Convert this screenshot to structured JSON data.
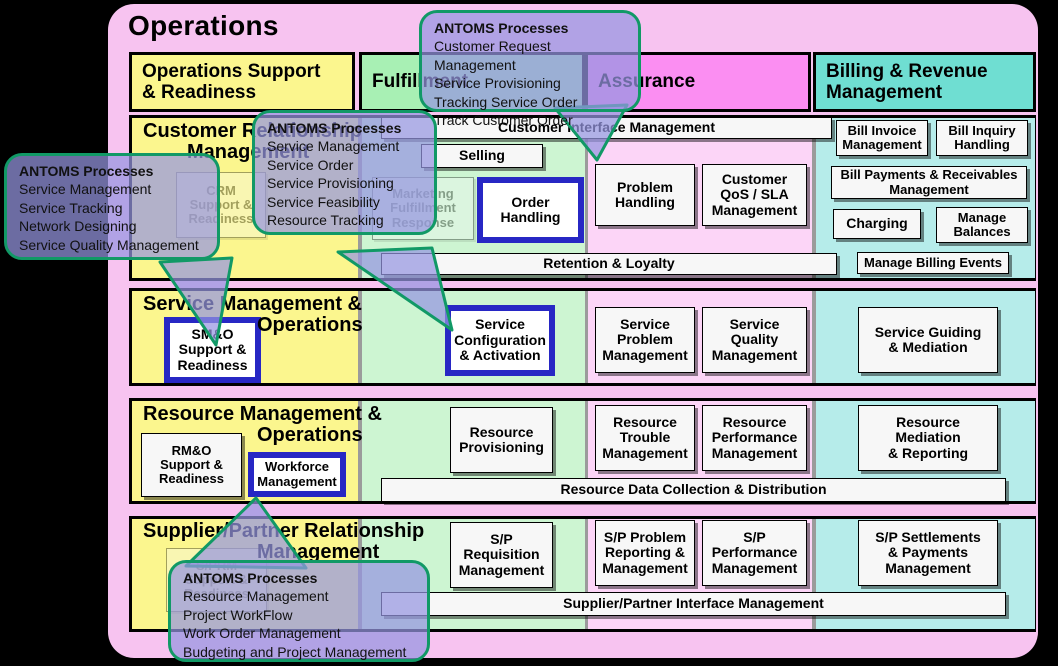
{
  "title": "Operations",
  "columns": [
    {
      "id": "osr",
      "label": "Operations Support\n& Readiness",
      "color": "#fbf68e"
    },
    {
      "id": "fulfillment",
      "label": "Fulfillment",
      "color": "#a8f0b4"
    },
    {
      "id": "assurance",
      "label": "Assurance",
      "color": "#fb8ef2"
    },
    {
      "id": "billing",
      "label": "Billing & Revenue\nManagement",
      "color": "#6fded2"
    }
  ],
  "column_headers": {
    "osr_l1": "Operations Support",
    "osr_l2": "& Readiness",
    "fulfillment": "Fulfillment",
    "assurance": "Assurance",
    "billing_l1": "Billing & Revenue",
    "billing_l2": "Management"
  },
  "rows": [
    {
      "id": "crm",
      "title_l1": "Customer  Relationship",
      "title_l2": "Management",
      "boxes": {
        "crm_support": "CRM\nSupport &\nReadiness",
        "customer_interface": "Customer Interface Management",
        "selling": "Selling",
        "marketing_fulfillment": "Marketing\nFulfillment\nResponse",
        "order_handling": "Order\nHandling",
        "problem_handling": "Problem\nHandling",
        "customer_qos": "Customer\nQoS / SLA\nManagement",
        "retention": "Retention & Loyalty",
        "bill_invoice": "Bill Invoice\nManagement",
        "bill_inquiry": "Bill Inquiry\nHandling",
        "bill_payments": "Bill Payments & Receivables\nManagement",
        "charging": "Charging",
        "manage_balances": "Manage\nBalances",
        "manage_billing_events": "Manage Billing Events"
      }
    },
    {
      "id": "sm",
      "title_l1": "Service Management &",
      "title_l2": "Operations",
      "boxes": {
        "smo_support": "SM&O\nSupport &\nReadiness",
        "service_config": "Service\nConfiguration\n& Activation",
        "service_problem": "Service\nProblem\nManagement",
        "service_quality": "Service\nQuality\nManagement",
        "service_guiding": "Service Guiding\n& Mediation"
      }
    },
    {
      "id": "rm",
      "title_l1": "Resource Management &",
      "title_l2": "Operations",
      "boxes": {
        "rmo_support": "RM&O\nSupport &\nReadiness",
        "workforce": "Workforce\nManagement",
        "resource_provisioning": "Resource\nProvisioning",
        "resource_trouble": "Resource\nTrouble\nManagement",
        "resource_performance": "Resource\nPerformance\nManagement",
        "resource_mediation": "Resource Mediation\n& Reporting",
        "resource_data": "Resource Data Collection & Distribution"
      }
    },
    {
      "id": "sprm",
      "title_l1": "Supplier/Partner  Relationship",
      "title_l2": "Management",
      "boxes": {
        "sprm_support": "S/PRM\nSupport &\nReadiness",
        "sp_requisition": "S/P\nRequisition\nManagement",
        "sp_problem": "S/P Problem\nReporting &\nManagement",
        "sp_performance": "S/P\nPerformance\nManagement",
        "sp_settlements": "S/P Settlements\n& Payments\nManagement",
        "sp_interface": "Supplier/Partner Interface Management"
      }
    }
  ],
  "callouts": [
    {
      "id": "callout-top",
      "header": "ANTOMS Processes",
      "items": [
        "Customer Request Management",
        "Service Provisioning",
        "Tracking Service Order",
        "Track Customer Order"
      ]
    },
    {
      "id": "callout-left",
      "header": "ANTOMS Processes",
      "items": [
        "Service Management",
        "Service Tracking",
        "Network Designing",
        "Service Quality Management"
      ]
    },
    {
      "id": "callout-mid",
      "header": "ANTOMS Processes",
      "items": [
        "Service Management",
        "Service Order",
        "Service Provisioning",
        "Service Feasibility",
        "Resource Tracking"
      ]
    },
    {
      "id": "callout-bottom",
      "header": "ANTOMS Processes",
      "items": [
        "Resource Management",
        "Project WorkFlow",
        "Work Order Management",
        "Budgeting and Project Management"
      ]
    }
  ],
  "colors": {
    "panel": "#f7c3f0",
    "osr": "#fbf68e",
    "fulfillment": "#a8f0b4",
    "assurance": "#fb8ef2",
    "billing": "#6fded2",
    "highlight": "#2727c4",
    "callout_border": "#119966",
    "callout_fill": "#9696e1"
  }
}
